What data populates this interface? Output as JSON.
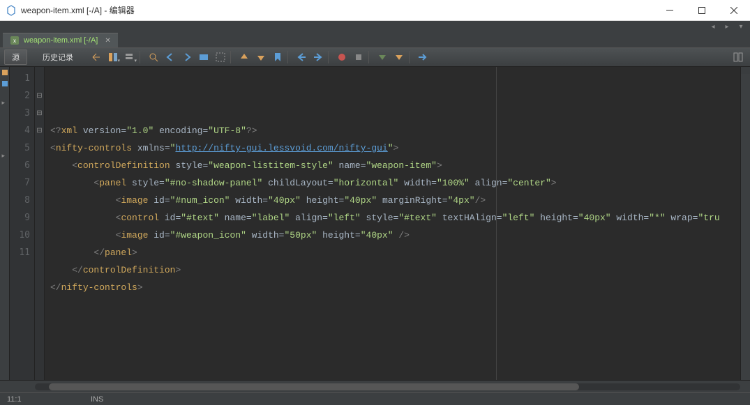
{
  "window": {
    "title": "weapon-item.xml [-/A] - 编辑器"
  },
  "tab": {
    "label": "weapon-item.xml [-/A]"
  },
  "toolbar": {
    "source": "源",
    "history": "历史记录"
  },
  "code": {
    "lines": [
      {
        "n": 1,
        "indent": 0,
        "parts": [
          {
            "c": "t-xml",
            "t": "<?"
          },
          {
            "c": "t-tag",
            "t": "xml "
          },
          {
            "c": "t-attr",
            "t": "version="
          },
          {
            "c": "t-str",
            "t": "\"1.0\""
          },
          {
            "c": "t-attr",
            "t": " encoding="
          },
          {
            "c": "t-str",
            "t": "\"UTF-8\""
          },
          {
            "c": "t-xml",
            "t": "?>"
          }
        ]
      },
      {
        "n": 2,
        "indent": 0,
        "parts": [
          {
            "c": "t-xml",
            "t": "<"
          },
          {
            "c": "t-tag",
            "t": "nifty-controls "
          },
          {
            "c": "t-attr",
            "t": "xmlns="
          },
          {
            "c": "t-str",
            "t": "\""
          },
          {
            "c": "t-link",
            "t": "http://nifty-gui.lessvoid.com/nifty-gui"
          },
          {
            "c": "t-str",
            "t": "\""
          },
          {
            "c": "t-xml",
            "t": ">"
          }
        ]
      },
      {
        "n": 3,
        "indent": 1,
        "parts": [
          {
            "c": "t-xml",
            "t": "<"
          },
          {
            "c": "t-tag",
            "t": "controlDefinition "
          },
          {
            "c": "t-attr",
            "t": "style="
          },
          {
            "c": "t-str",
            "t": "\"weapon-listitem-style\""
          },
          {
            "c": "t-attr",
            "t": " name="
          },
          {
            "c": "t-str",
            "t": "\"weapon-item\""
          },
          {
            "c": "t-xml",
            "t": ">"
          }
        ]
      },
      {
        "n": 4,
        "indent": 2,
        "parts": [
          {
            "c": "t-xml",
            "t": "<"
          },
          {
            "c": "t-tag",
            "t": "panel "
          },
          {
            "c": "t-attr",
            "t": "style="
          },
          {
            "c": "t-str",
            "t": "\"#no-shadow-panel\""
          },
          {
            "c": "t-attr",
            "t": " childLayout="
          },
          {
            "c": "t-str",
            "t": "\"horizontal\""
          },
          {
            "c": "t-attr",
            "t": " width="
          },
          {
            "c": "t-str",
            "t": "\"100%\""
          },
          {
            "c": "t-attr",
            "t": " align="
          },
          {
            "c": "t-str",
            "t": "\"center\""
          },
          {
            "c": "t-xml",
            "t": ">"
          }
        ]
      },
      {
        "n": 5,
        "indent": 3,
        "parts": [
          {
            "c": "t-xml",
            "t": "<"
          },
          {
            "c": "t-tag",
            "t": "image "
          },
          {
            "c": "t-attr",
            "t": "id="
          },
          {
            "c": "t-str",
            "t": "\"#num_icon\""
          },
          {
            "c": "t-attr",
            "t": " width="
          },
          {
            "c": "t-str",
            "t": "\"40px\""
          },
          {
            "c": "t-attr",
            "t": " height="
          },
          {
            "c": "t-str",
            "t": "\"40px\""
          },
          {
            "c": "t-attr",
            "t": " marginRight="
          },
          {
            "c": "t-str",
            "t": "\"4px\""
          },
          {
            "c": "t-xml",
            "t": "/>"
          }
        ]
      },
      {
        "n": 6,
        "indent": 3,
        "parts": [
          {
            "c": "t-xml",
            "t": "<"
          },
          {
            "c": "t-tag",
            "t": "control "
          },
          {
            "c": "t-attr",
            "t": "id="
          },
          {
            "c": "t-str",
            "t": "\"#text\""
          },
          {
            "c": "t-attr",
            "t": " name="
          },
          {
            "c": "t-str",
            "t": "\"label\""
          },
          {
            "c": "t-attr",
            "t": " align="
          },
          {
            "c": "t-str",
            "t": "\"left\""
          },
          {
            "c": "t-attr",
            "t": " style="
          },
          {
            "c": "t-str",
            "t": "\"#text\""
          },
          {
            "c": "t-attr",
            "t": " textHAlign="
          },
          {
            "c": "t-str",
            "t": "\"left\""
          },
          {
            "c": "t-attr",
            "t": " height="
          },
          {
            "c": "t-str",
            "t": "\"40px\""
          },
          {
            "c": "t-attr",
            "t": " width="
          },
          {
            "c": "t-str",
            "t": "\"*\""
          },
          {
            "c": "t-attr",
            "t": " wrap="
          },
          {
            "c": "t-str",
            "t": "\"tru"
          }
        ]
      },
      {
        "n": 7,
        "indent": 3,
        "parts": [
          {
            "c": "t-xml",
            "t": "<"
          },
          {
            "c": "t-tag",
            "t": "image "
          },
          {
            "c": "t-attr",
            "t": "id="
          },
          {
            "c": "t-str",
            "t": "\"#weapon_icon\""
          },
          {
            "c": "t-attr",
            "t": " width="
          },
          {
            "c": "t-str",
            "t": "\"50px\""
          },
          {
            "c": "t-attr",
            "t": " height="
          },
          {
            "c": "t-str",
            "t": "\"40px\""
          },
          {
            "c": "t-xml",
            "t": " />"
          }
        ]
      },
      {
        "n": 8,
        "indent": 2,
        "parts": [
          {
            "c": "t-xml",
            "t": "</"
          },
          {
            "c": "t-tag",
            "t": "panel"
          },
          {
            "c": "t-xml",
            "t": ">"
          }
        ]
      },
      {
        "n": 9,
        "indent": 1,
        "parts": [
          {
            "c": "t-xml",
            "t": "</"
          },
          {
            "c": "t-tag",
            "t": "controlDefinition"
          },
          {
            "c": "t-xml",
            "t": ">"
          }
        ]
      },
      {
        "n": 10,
        "indent": 0,
        "parts": [
          {
            "c": "t-xml",
            "t": "</"
          },
          {
            "c": "t-tag",
            "t": "nifty-controls"
          },
          {
            "c": "t-xml",
            "t": ">"
          }
        ]
      },
      {
        "n": 11,
        "indent": 0,
        "parts": []
      }
    ]
  },
  "status": {
    "pos": "11:1",
    "mode": "INS"
  }
}
